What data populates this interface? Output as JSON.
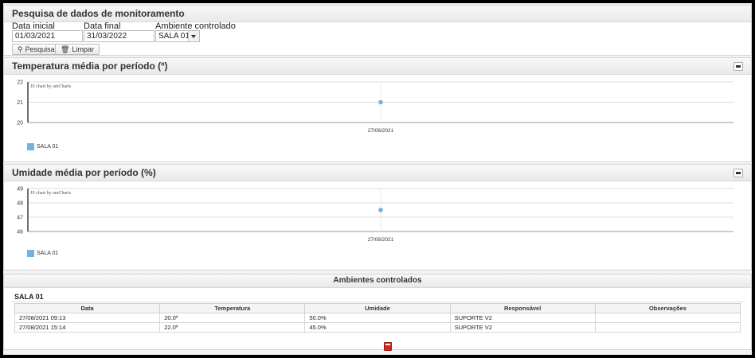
{
  "search": {
    "title": "Pesquisa de dados de monitoramento",
    "start_label": "Data inicial",
    "start_value": "01/03/2021",
    "end_label": "Data final",
    "end_value": "31/03/2022",
    "env_label": "Ambiente controlado",
    "env_value": "SALA 01",
    "search_button": "Pesquisar",
    "clear_button": "Limpar"
  },
  "temp_panel": {
    "title": "Temperatura média por período (º)",
    "credit": "JS chart by amCharts"
  },
  "humidity_panel": {
    "title": "Umidade média por período (%)",
    "credit": "JS chart by amCharts"
  },
  "chart_data": [
    {
      "type": "line",
      "title": "Temperatura média por período (º)",
      "x": [
        "27/08/2021"
      ],
      "series": [
        {
          "name": "SALA 01",
          "values": [
            21
          ],
          "color": "#6db4e3"
        }
      ],
      "ylim": [
        20,
        22
      ],
      "yticks": [
        "20",
        "21",
        "22"
      ],
      "legend": "bottom-left",
      "grid": true
    },
    {
      "type": "line",
      "title": "Umidade média por período (%)",
      "x": [
        "27/08/2021"
      ],
      "series": [
        {
          "name": "SALA 01",
          "values": [
            47.5
          ],
          "color": "#6db4e3"
        }
      ],
      "ylim": [
        46,
        49
      ],
      "yticks": [
        "46",
        "47",
        "48",
        "49"
      ],
      "legend": "bottom-left",
      "grid": true
    }
  ],
  "environments": {
    "title": "Ambientes controlados",
    "room": "SALA 01",
    "columns": [
      "Data",
      "Temperatura",
      "Umidade",
      "Responsável",
      "Observações"
    ],
    "rows": [
      [
        "27/08/2021 09:13",
        "20.0º",
        "50.0%",
        "SUPORTE V2",
        ""
      ],
      [
        "27/08/2021 15:14",
        "22.0º",
        "45.0%",
        "SUPORTE V2",
        ""
      ]
    ]
  },
  "icons": {
    "search": "magnifier-icon",
    "clear": "trash-icon",
    "export": "pdf-icon"
  }
}
